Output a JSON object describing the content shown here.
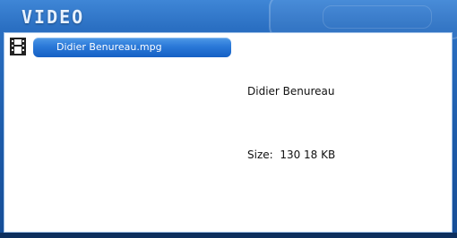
{
  "header": {
    "title": "VIDEO"
  },
  "file_list": {
    "items": [
      {
        "label": "Didier Benureau.mpg",
        "icon": "film-icon"
      }
    ]
  },
  "details": {
    "name": "Didier Benureau",
    "size_label": "Size:",
    "size_value": "130 18 KB"
  },
  "colors": {
    "frame": "#1c5aa8",
    "selection": "#2a78d8",
    "panel": "#ffffff",
    "text": "#111111"
  }
}
